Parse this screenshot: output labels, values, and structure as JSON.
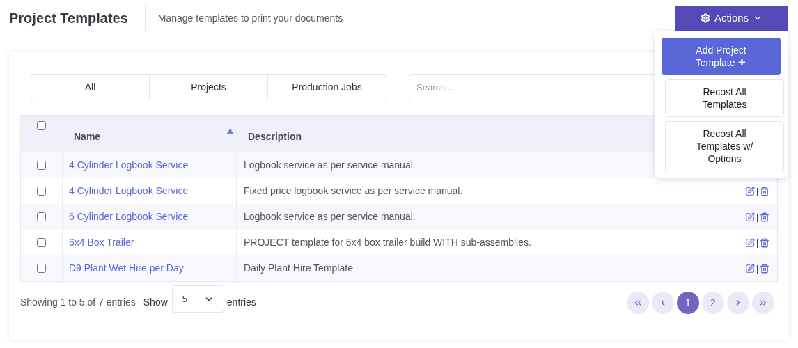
{
  "header": {
    "title": "Project Templates",
    "subtitle": "Manage templates to print your documents"
  },
  "actions_button": {
    "label": "Actions",
    "expanded": true
  },
  "actions_menu": [
    {
      "label": "Add Project Template",
      "kind": "primary"
    },
    {
      "label": "Recost All Templates",
      "kind": "plain"
    },
    {
      "label": "Recost All Templates w/ Options",
      "kind": "plain"
    }
  ],
  "filter_tabs": [
    {
      "label": "All",
      "selected": false
    },
    {
      "label": "Projects",
      "selected": false
    },
    {
      "label": "Production Jobs",
      "selected": false
    }
  ],
  "search": {
    "placeholder": "Search..."
  },
  "table": {
    "select_all": {
      "checked": false
    },
    "columns": [
      {
        "label": "Name",
        "sorted": true
      },
      {
        "label": "Description"
      }
    ],
    "rows": [
      {
        "checked": false,
        "name": "4 Cylinder Logbook Service",
        "description": "Logbook service as per service manual."
      },
      {
        "checked": false,
        "name": "4 Cylinder Logbook Service",
        "description": "Fixed price logbook service as per service manual.",
        "separator": "|"
      },
      {
        "checked": false,
        "name": "6 Cylinder Logbook Service",
        "description": "Logbook service as per service manual.",
        "separator": "|"
      },
      {
        "checked": false,
        "name": "6x4 Box Trailer",
        "description": "PROJECT template for 6x4 box trailer build WITH sub-assemblies.",
        "separator": "|"
      },
      {
        "checked": false,
        "name": "D9 Plant Wet Hire per Day",
        "description": "Daily Plant Hire Template",
        "separator": "|"
      }
    ]
  },
  "footer": {
    "info": "Showing 1 to 5 of 7 entries",
    "show_label": "Show",
    "page_size": "5",
    "entries_label": "entries"
  },
  "pagination": [
    {
      "kind": "first",
      "selected": false
    },
    {
      "kind": "prev",
      "selected": false
    },
    {
      "kind": "page",
      "label": "1",
      "selected": true
    },
    {
      "kind": "page",
      "label": "2",
      "selected": false
    },
    {
      "kind": "next",
      "selected": false
    },
    {
      "kind": "last",
      "selected": false
    }
  ]
}
